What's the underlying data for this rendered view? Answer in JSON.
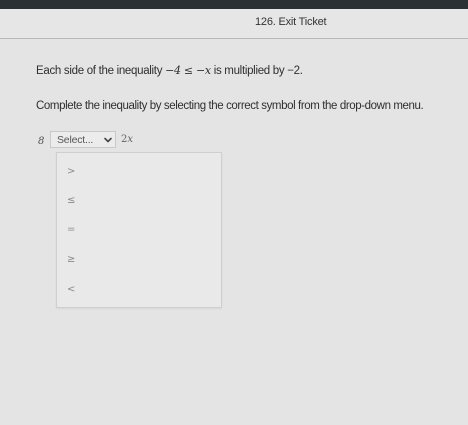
{
  "header": {
    "title": "126. Exit Ticket"
  },
  "question": {
    "prefix": "Each side of the inequality ",
    "inequality": "−4 ≤ −x",
    "middle": " is multiplied by ",
    "multiplier": "−2.",
    "instruction": "Complete the inequality by selecting the correct symbol from the drop-down menu."
  },
  "answer": {
    "lhs": "8",
    "select_label": "Select...",
    "rhs_coef": "2",
    "rhs_var": "x"
  },
  "dropdown": {
    "options": [
      ">",
      "≤",
      "=",
      "≥",
      "<"
    ]
  },
  "colors": {
    "top_bar": "#2b3035",
    "background": "#e4e4e4",
    "option_text": "#8a8a8a"
  }
}
